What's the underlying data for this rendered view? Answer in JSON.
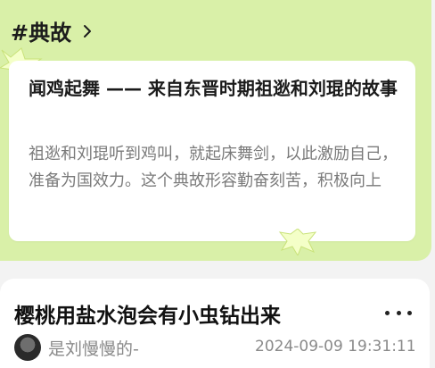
{
  "allusion": {
    "header": "#典故",
    "title": "闻鸡起舞 —— 来自东晋时期祖逖和刘琨的故事",
    "description": "祖逖和刘琨听到鸡叫，就起床舞剑，以此激励自己，准备为国效力。这个典故形容勤奋刻苦，积极向上"
  },
  "post": {
    "title": "樱桃用盐水泡会有小虫钻出来",
    "author": "是刘慢慢的-",
    "time": "2024-09-09 19:31:11"
  },
  "colors": {
    "card_bg": "#d9f0a8",
    "page_bg": "#f3f3f3",
    "spark": "#f4ffc8"
  },
  "icons": [
    "chevron-right-icon",
    "sparkle-icon",
    "more-icon"
  ]
}
